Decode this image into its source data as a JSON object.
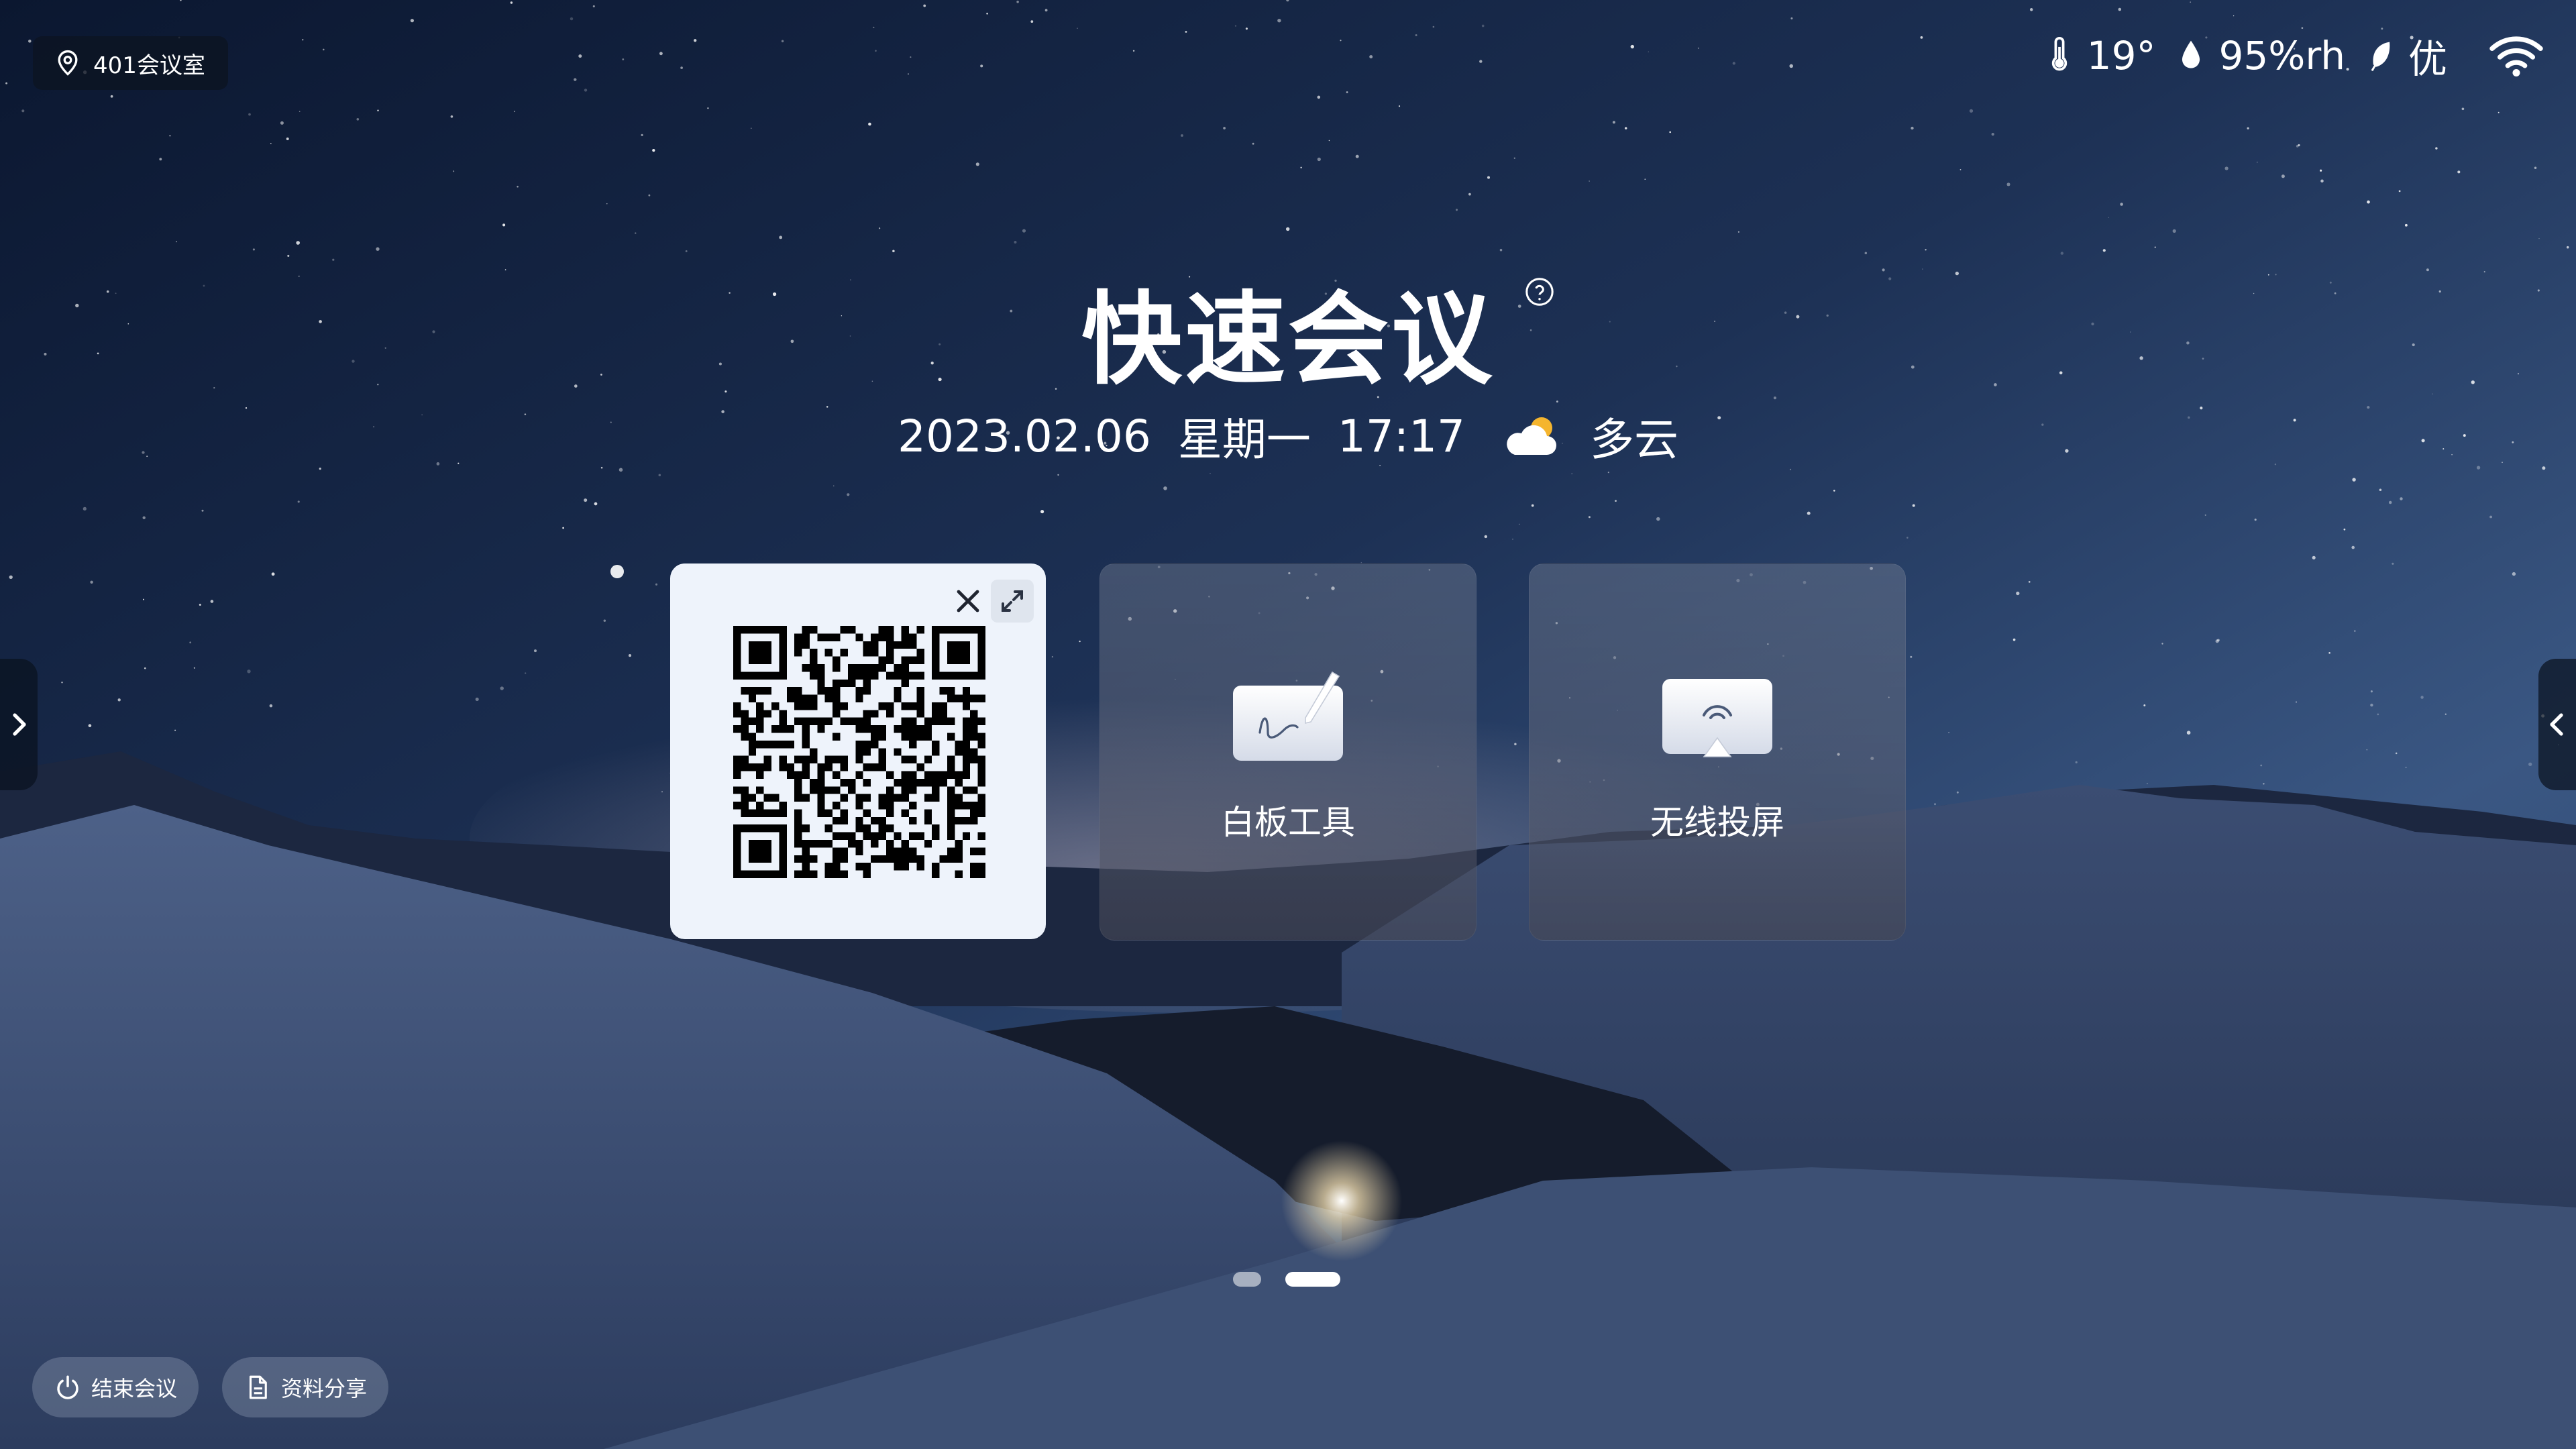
{
  "room": {
    "icon": "location-pin-icon",
    "name": "401会议室"
  },
  "status": {
    "temperature": "19°",
    "humidity": "95%rh",
    "air_quality": "优",
    "icons": [
      "thermometer-icon",
      "humidity-drop-icon",
      "leaf-icon",
      "wifi-icon"
    ]
  },
  "header": {
    "title": "快速会议",
    "date": "2023.02.06",
    "weekday": "星期一",
    "time": "17:17",
    "weather": "多云",
    "weather_icon": "partly-cloudy-icon"
  },
  "cards": {
    "qr": {
      "close_icon": "close-icon",
      "expand_icon": "expand-icon"
    },
    "whiteboard": {
      "label": "白板工具",
      "icon": "whiteboard-icon"
    },
    "screencast": {
      "label": "无线投屏",
      "icon": "screencast-icon"
    }
  },
  "pager": {
    "total": 2,
    "active": 2
  },
  "footer": {
    "end_meeting": "结束会议",
    "share_files": "资料分享"
  },
  "colors": {
    "sky_top": "#0d1a33",
    "sky_mid": "#2b4066",
    "snow": "#3a4d70",
    "qr_card": "#eef3fb"
  }
}
